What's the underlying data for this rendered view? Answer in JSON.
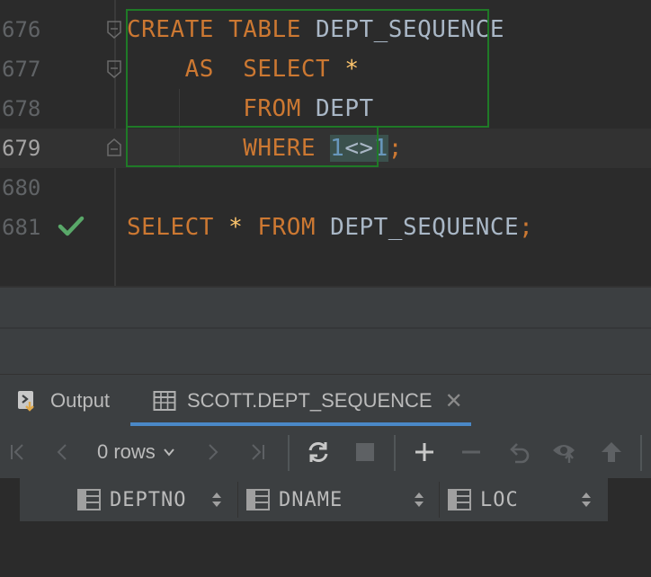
{
  "editor": {
    "lines": [
      {
        "number": "676",
        "tokens": [
          "CREATE",
          "TABLE",
          "DEPT_SEQUENCE"
        ]
      },
      {
        "number": "677",
        "tokens": [
          "AS",
          "SELECT",
          "*"
        ]
      },
      {
        "number": "678",
        "tokens": [
          "FROM",
          "DEPT"
        ]
      },
      {
        "number": "679",
        "tokens": [
          "WHERE",
          "1",
          "<>",
          "1",
          ";"
        ]
      },
      {
        "number": "680",
        "tokens": []
      },
      {
        "number": "681",
        "tokens": [
          "SELECT",
          "*",
          "FROM",
          "DEPT_SEQUENCE",
          ";"
        ]
      }
    ],
    "current_line": "679"
  },
  "colors": {
    "keyword": "#cc7832",
    "identifier": "#a9b7c6",
    "number": "#6897bb",
    "success": "#59a869",
    "accent_tab": "#4a88c7",
    "statement_box": "#1f7a27"
  },
  "tabs": [
    {
      "label": "Output",
      "icon": "output-icon"
    },
    {
      "label": "SCOTT.DEPT_SEQUENCE",
      "icon": "table-icon",
      "active": true
    }
  ],
  "toolbar": {
    "rows_label": "0 rows",
    "icons": [
      "first-page-icon",
      "prev-page-icon",
      "next-page-icon",
      "last-page-icon",
      "refresh-icon",
      "stop-icon",
      "add-row-icon",
      "delete-row-icon",
      "revert-icon",
      "preview-icon",
      "submit-icon"
    ]
  },
  "grid": {
    "columns": [
      "DEPTNO",
      "DNAME",
      "LOC"
    ]
  }
}
